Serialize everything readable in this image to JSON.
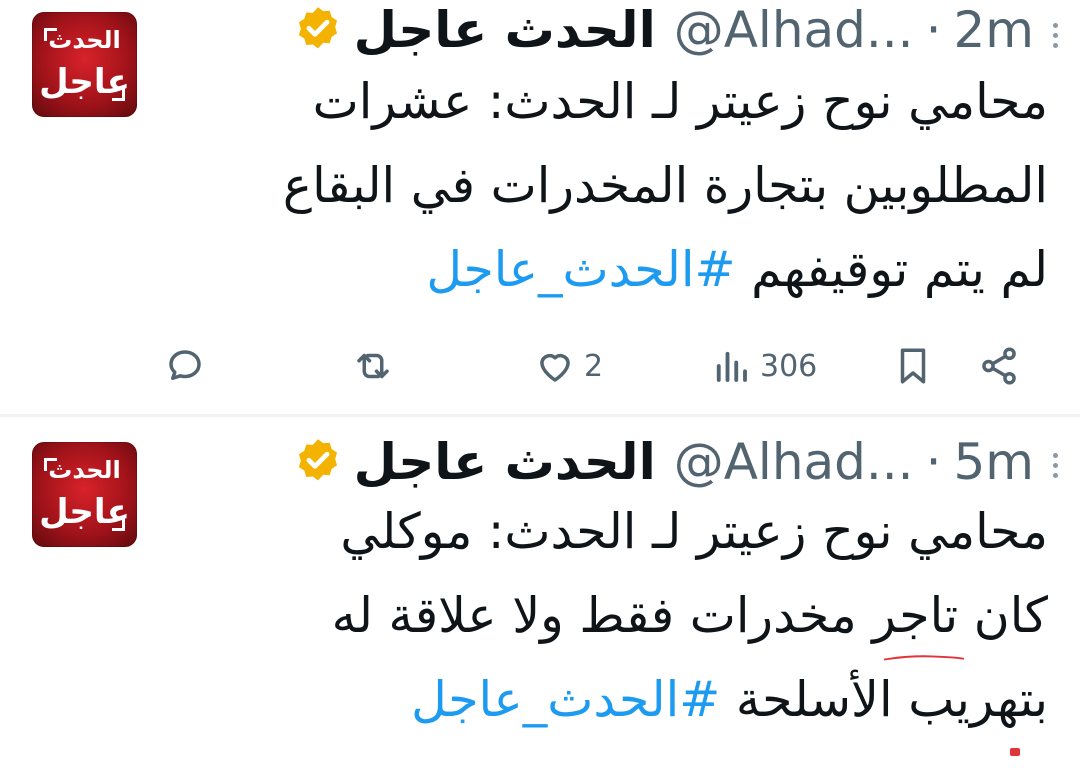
{
  "tweets": [
    {
      "author_name": "الحدث عاجل",
      "handle": "@Alhad...",
      "separator": "·",
      "time": "2m",
      "avatar_top": "الحدث",
      "avatar_bottom": "عاجل",
      "lines": [
        "محامي نوح زعيتر لـ الحدث: عشرات",
        "المطلوبين بتجارة المخدرات في البقاع",
        "لم يتم توقيفهم"
      ],
      "hashtag": "#الحدث_عاجل",
      "likes": "2",
      "views": "306"
    },
    {
      "author_name": "الحدث عاجل",
      "handle": "@Alhad...",
      "separator": "·",
      "time": "5m",
      "avatar_top": "الحدث",
      "avatar_bottom": "عاجل",
      "line1": "محامي نوح زعيتر لـ الحدث: موكلي",
      "line2_a": "كان",
      "line2_underlined": "تاجر  مخدرات فقط",
      "line2_b": "ولا علاقة له",
      "line3": "بتهريب الأسلحة",
      "hashtag": "#الحدث_عاجل"
    }
  ],
  "colors": {
    "link": "#1d9bf0",
    "verified": "#f4b300",
    "avatar": "#c4161c",
    "annotation": "#e0333a"
  }
}
